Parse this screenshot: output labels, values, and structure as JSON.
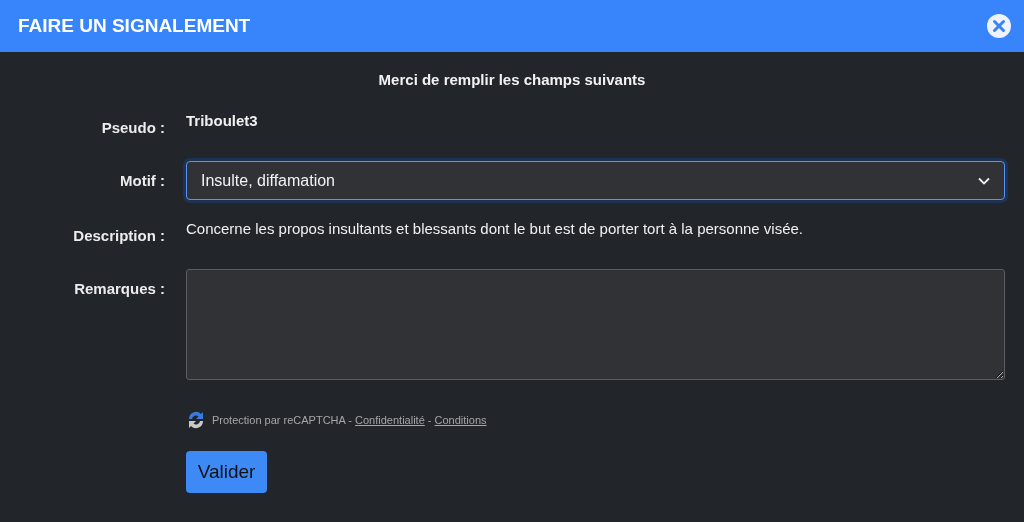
{
  "dialog": {
    "title": "FAIRE UN SIGNALEMENT"
  },
  "intro": "Merci de remplir les champs suivants",
  "fields": [
    {
      "kind": "text",
      "label": "Pseudo :",
      "value": "Triboulet3",
      "bold": true
    },
    {
      "kind": "select",
      "label": "Motif :",
      "value": "Insulte, diffamation",
      "focused": true
    },
    {
      "kind": "text",
      "label": "Description :",
      "value": "Concerne les propos insultants et blessants dont le but est de porter tort à la personne visée.",
      "bold": false
    },
    {
      "kind": "textarea",
      "label": "Remarques :"
    }
  ],
  "recaptcha": {
    "prefix": "Protection par reCAPTCHA",
    "separator": "-",
    "links": [
      "Confidentialité",
      "Conditions"
    ]
  },
  "submit": "Valider"
}
